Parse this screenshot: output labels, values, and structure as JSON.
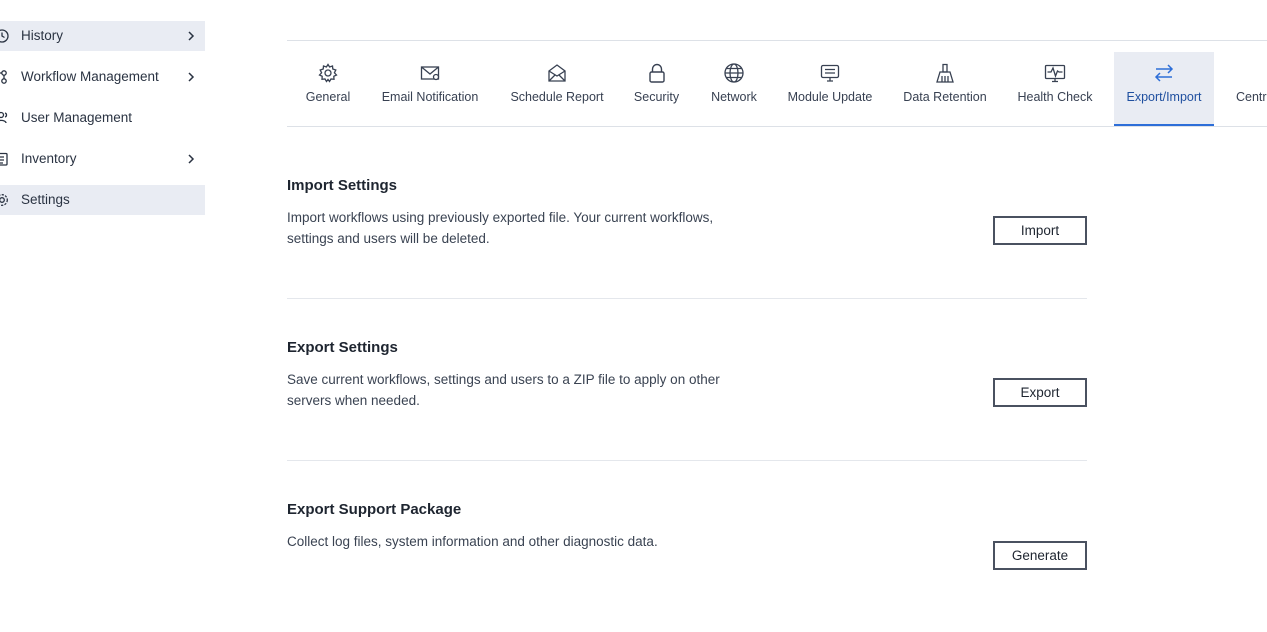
{
  "sidebar": {
    "items": [
      {
        "label": "History",
        "icon": "history-icon",
        "active": true
      },
      {
        "label": "Workflow Management",
        "icon": "workflow-icon"
      },
      {
        "label": "User Management",
        "icon": "users-icon"
      },
      {
        "label": "Inventory",
        "icon": "clipboard-icon"
      },
      {
        "label": "Settings",
        "icon": "gear-icon",
        "active": true
      }
    ]
  },
  "tabs": [
    {
      "label": "General",
      "icon": "gear-icon"
    },
    {
      "label": "Email Notification",
      "icon": "envelope-icon"
    },
    {
      "label": "Schedule Report",
      "icon": "open-envelope-icon"
    },
    {
      "label": "Security",
      "icon": "lock-icon"
    },
    {
      "label": "Network",
      "icon": "globe-icon"
    },
    {
      "label": "Module Update",
      "icon": "monitor-icon"
    },
    {
      "label": "Data Retention",
      "icon": "broom-icon"
    },
    {
      "label": "Health Check",
      "icon": "heartbeat-monitor-icon"
    },
    {
      "label": "Export/Import",
      "icon": "swap-arrows-icon",
      "active": true
    },
    {
      "label": "Centra"
    }
  ],
  "sections": [
    {
      "title": "Import Settings",
      "description": "Import workflows using previously exported file. Your current workflows, settings and users will be deleted.",
      "button": "Import"
    },
    {
      "title": "Export Settings",
      "description": "Save current workflows, settings and users to a ZIP file to apply on other servers when needed.",
      "button": "Export"
    },
    {
      "title": "Export Support Package",
      "description": "Collect log files, system information and other diagnostic data.",
      "button": "Generate"
    }
  ],
  "colors": {
    "accent": "#2d6ed8",
    "active_bg": "#e9ecf3",
    "text": "#222a35"
  }
}
